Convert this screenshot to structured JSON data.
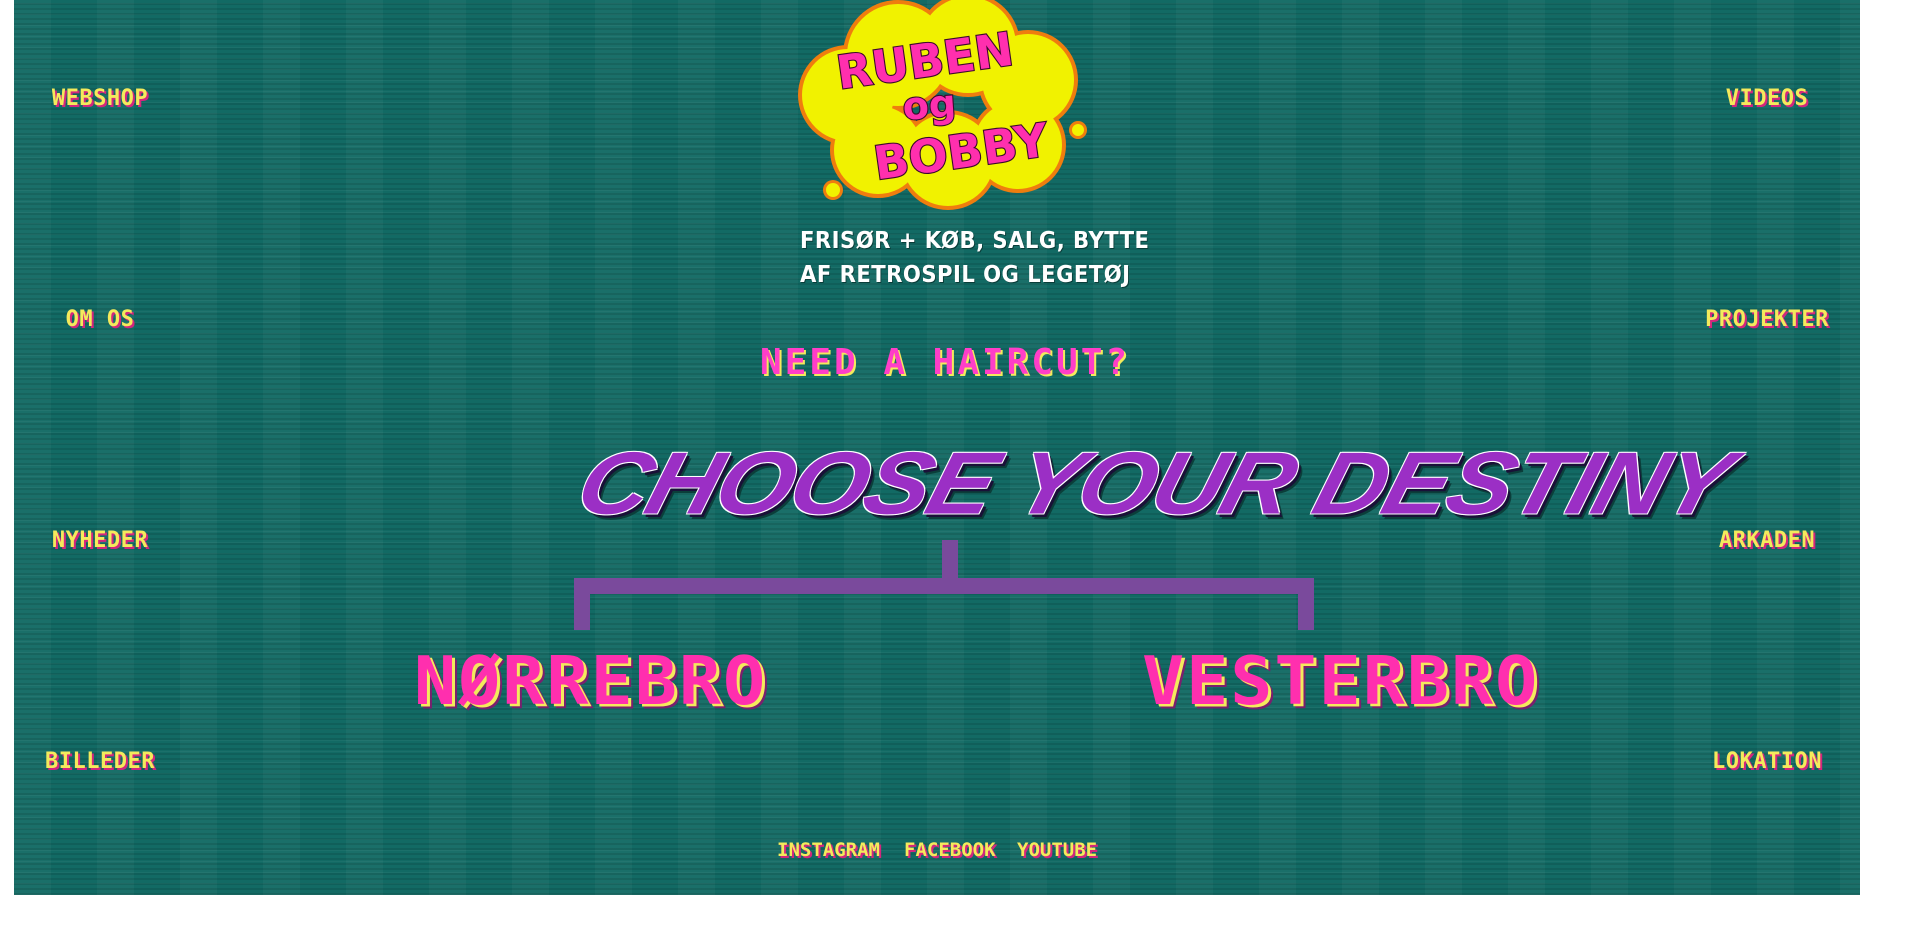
{
  "nav_left": [
    {
      "label": "WEBSHOP"
    },
    {
      "label": "OM OS"
    },
    {
      "label": "NYHEDER"
    },
    {
      "label": "BILLEDER"
    }
  ],
  "nav_right": [
    {
      "label": "VIDEOS"
    },
    {
      "label": "PROJEKTER"
    },
    {
      "label": "ARKADEN"
    },
    {
      "label": "LOKATION"
    }
  ],
  "logo": {
    "line1": "RUBEN",
    "line2": "og",
    "line3": "BOBBY"
  },
  "tagline": {
    "line1": "FRISØR + KØB, SALG, BYTTE",
    "line2": "AF RETROSPIL OG LEGETØJ"
  },
  "headline": "NEED A HAIRCUT?",
  "destiny": "CHOOSE YOUR DESTINY",
  "choices": {
    "left": "NØRREBRO",
    "right": "VESTERBRO"
  },
  "social": {
    "instagram": "INSTAGRAM",
    "facebook": "FACEBOOK",
    "youtube": "YOUTUBE"
  },
  "colors": {
    "background": "#126a64",
    "nav_text": "#f4ea5c",
    "accent_pink": "#ff2fae",
    "destiny_purple": "#9b2fc5",
    "logo_yellow": "#f1f200",
    "logo_orange": "#ef7d0e"
  }
}
